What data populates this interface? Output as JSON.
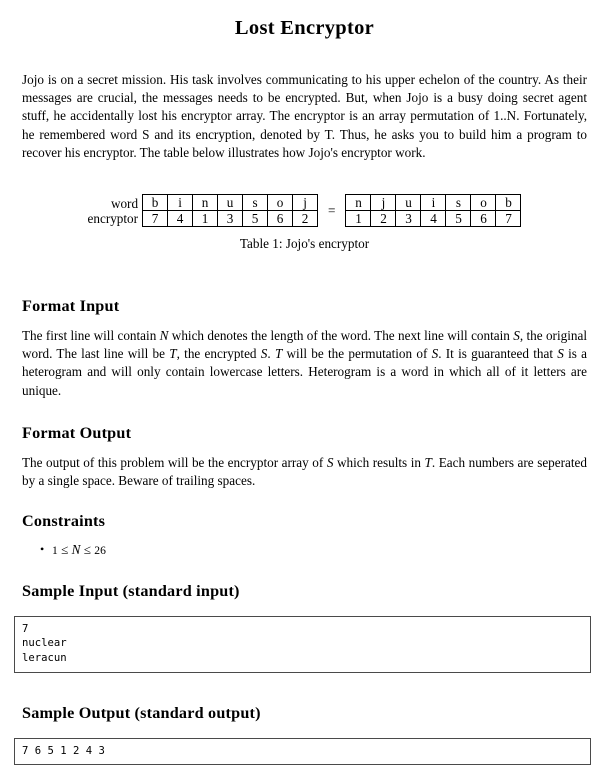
{
  "document": {
    "title": "Lost Encryptor",
    "intro_paragraph": "Jojo is on a secret mission. His task involves communicating to his upper echelon of the country. As their messages are crucial, the messages needs to be encrypted. But, when Jojo is a busy doing secret agent stuff, he accidentally lost his encryptor array. The encryptor is an array permutation of 1..N. Fortunately, he remembered word S and its encryption, denoted by T. Thus, he asks you to build him a program to recover his encryptor. The table below illustrates how Jojo's encryptor work."
  },
  "encryptor_table": {
    "caption": "Table 1: Jojo's encryptor",
    "row_label_word": "word",
    "row_label_encryptor": "encryptor",
    "equals_sign": "=",
    "left": {
      "word": [
        "b",
        "i",
        "n",
        "u",
        "s",
        "o",
        "j"
      ],
      "encryptor": [
        "7",
        "4",
        "1",
        "3",
        "5",
        "6",
        "2"
      ]
    },
    "right": {
      "word": [
        "n",
        "j",
        "u",
        "i",
        "s",
        "o",
        "b"
      ],
      "encryptor": [
        "1",
        "2",
        "3",
        "4",
        "5",
        "6",
        "7"
      ]
    }
  },
  "sections": {
    "format_input": {
      "heading": "Format Input",
      "body_1": "The first line will contain ",
      "body_var_1": "N",
      "body_2": " which denotes the length of the word. The next line will contain ",
      "body_var_2": "S",
      "body_3": ", the original word. The last line will be ",
      "body_var_3": "T",
      "body_4": ", the encrypted ",
      "body_var_4": "S",
      "body_5": ". ",
      "body_var_5": "T",
      "body_6": " will be the permutation of ",
      "body_var_6": "S",
      "body_7": ". It is guaranteed that ",
      "body_var_7": "S",
      "body_8": " is a heterogram and will only contain lowercase letters. Heterogram is a word in which all of it letters are unique."
    },
    "format_output": {
      "heading": "Format Output",
      "body_1": "The output of this problem will be the encryptor array of ",
      "body_var_1": "S",
      "body_2": " which results in ",
      "body_var_2": "T",
      "body_3": ". Each numbers are seperated by a single space. Beware of trailing spaces."
    },
    "constraints": {
      "heading": "Constraints",
      "items": [
        {
          "lower_bound": "1",
          "rel_left": "≤",
          "variable": "N",
          "rel_right": "≤",
          "upper_bound": "26"
        }
      ]
    },
    "sample_input": {
      "heading": "Sample Input (standard input)",
      "content": "7\nnuclear\nleracun"
    },
    "sample_output": {
      "heading": "Sample Output (standard output)",
      "content": "7 6 5 1 2 4 3"
    }
  }
}
